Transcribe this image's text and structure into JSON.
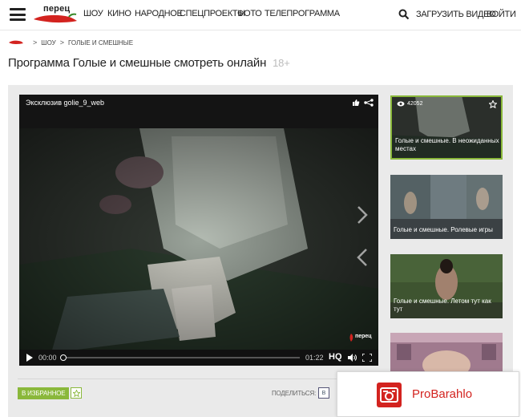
{
  "header": {
    "logo_text": "перец",
    "nav": [
      {
        "label": "ШОУ",
        "active": true
      },
      {
        "label": "КИНО"
      },
      {
        "label": "НАРОДНОЕ"
      },
      {
        "label": "СПЕЦПРОЕКТЫ"
      },
      {
        "label": "ФОТО"
      },
      {
        "label": "ТЕЛЕПРОГРАММА"
      }
    ],
    "upload_label": "ЗАГРУЗИТЬ ВИДЕО",
    "login_label": "ВОЙТИ"
  },
  "breadcrumb": {
    "items": [
      "ШОУ",
      "ГОЛЫЕ И СМЕШНЫЕ"
    ]
  },
  "page": {
    "title": "Программа Голые и смешные смотреть онлайн",
    "age_rating": "18+"
  },
  "player": {
    "video_title": "Эксклюзив golie_9_web",
    "current_time": "00:00",
    "total_time": "01:22",
    "quality_label": "HQ",
    "progress": 0,
    "watermark": "перец"
  },
  "sidebar": {
    "items": [
      {
        "views": "42052",
        "caption": "Голые и смешные. В неожиданных местах",
        "active": true
      },
      {
        "caption": "Голые и смешные. Ролевые игры"
      },
      {
        "caption": "Голые и смешные. Летом тут как тут"
      },
      {
        "caption": ""
      }
    ]
  },
  "actions": {
    "favorite_label": "В ИЗБРАННОЕ",
    "share_label": "ПОДЕЛИТЬСЯ:",
    "vk_label": "В"
  },
  "badge": {
    "text": "ProBarahlo"
  },
  "colors": {
    "accent_green": "#8ab83b",
    "brand_red": "#d3231f"
  }
}
